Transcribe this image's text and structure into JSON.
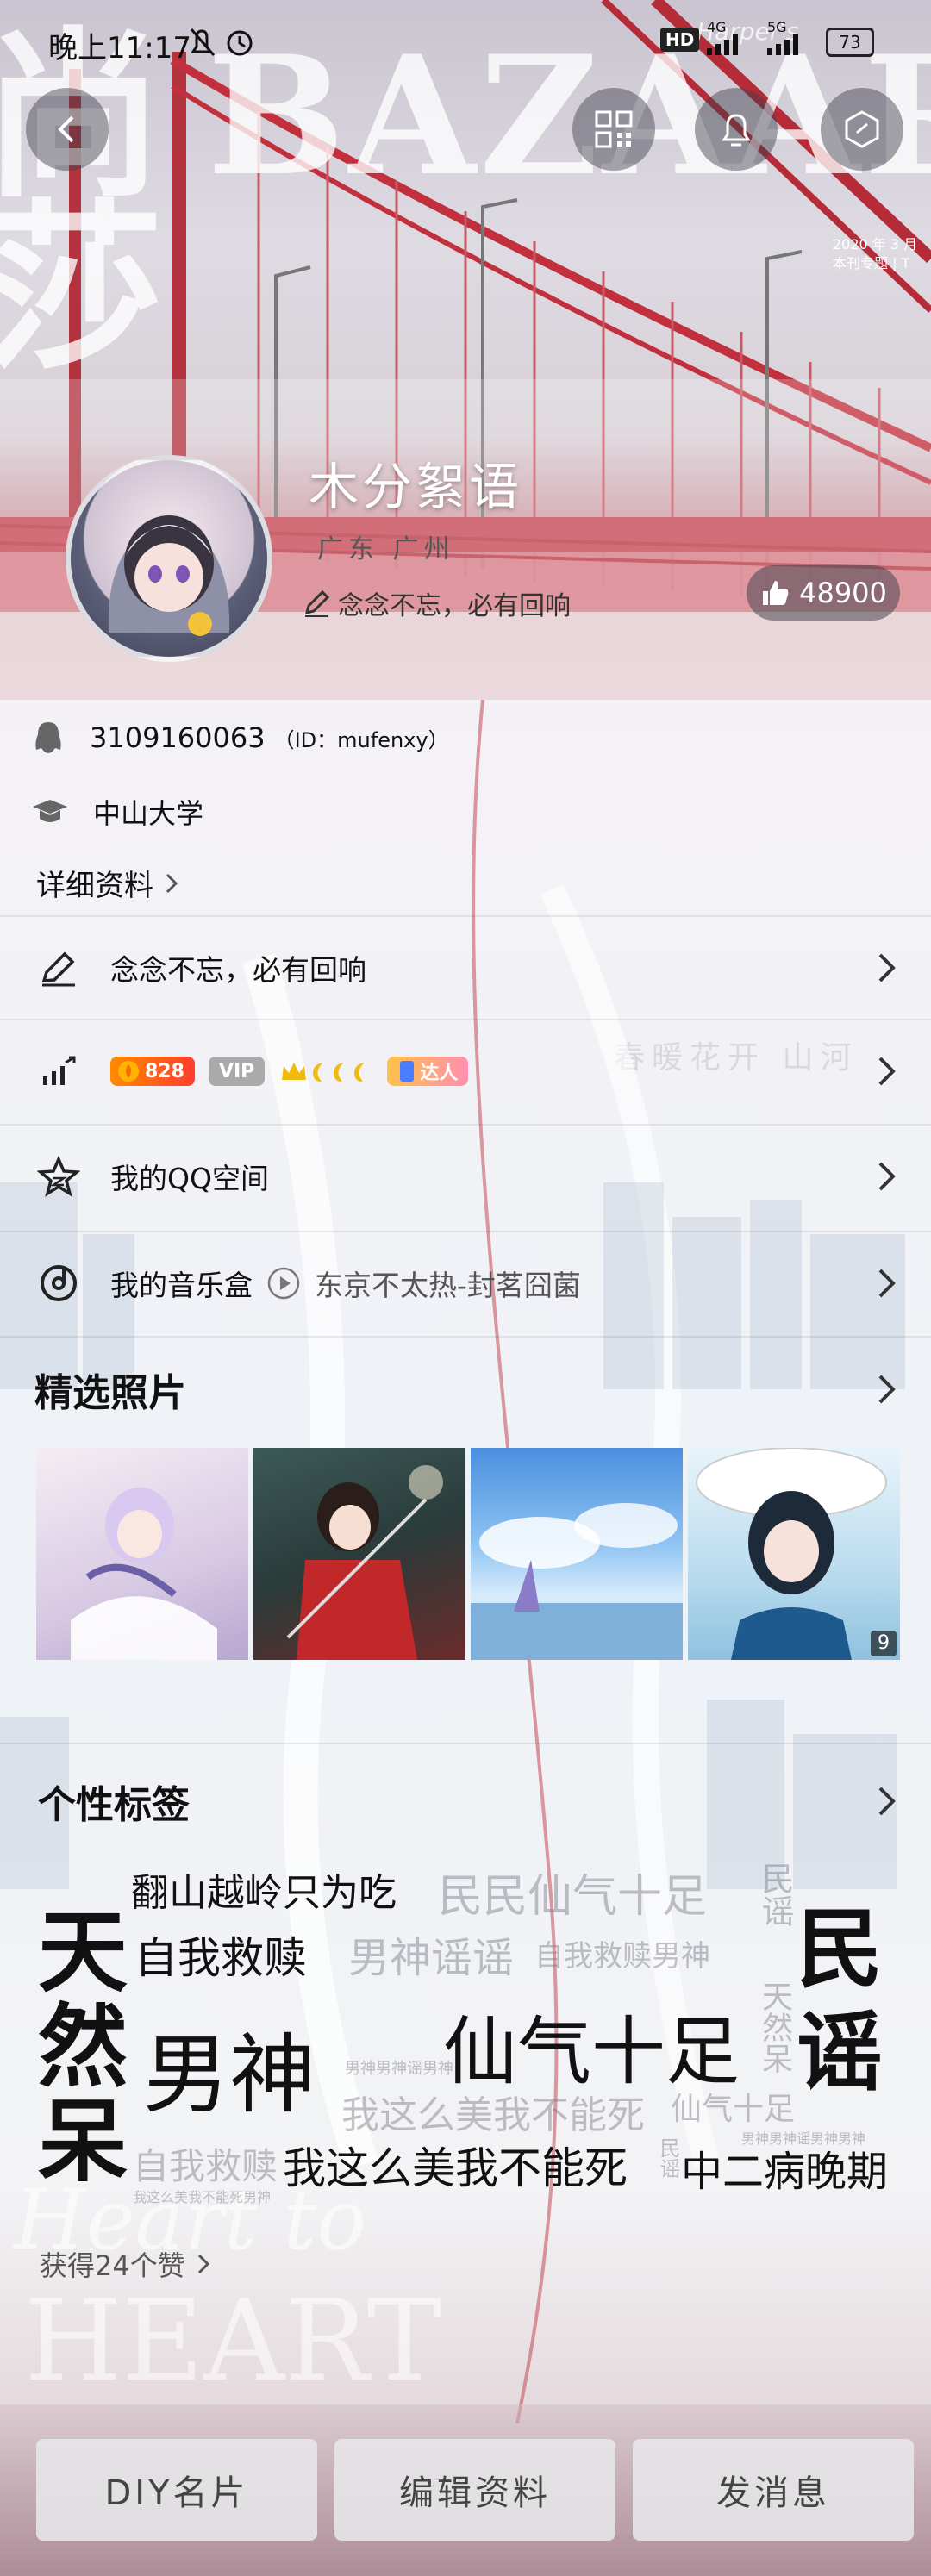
{
  "status_bar": {
    "time": "晚上11:17",
    "hd": "HD",
    "net1": "4G",
    "net2": "5G",
    "battery": "73"
  },
  "cover": {
    "magazine_left": "尚",
    "magazine_left2": "莎",
    "magazine_title": "BAZAAR",
    "magazine_small": "Harper's",
    "magazine_year": "2020 年 3 月",
    "magazine_note": "本刊专题 | T"
  },
  "profile": {
    "name": "木分絮语",
    "location": "广东 广州",
    "signature": "念念不忘，必有回响",
    "likes": "48900"
  },
  "info": {
    "qq_number": "3109160063",
    "qq_id": "（ID：mufenxy）",
    "school": "中山大学",
    "detail_link": "详细资料"
  },
  "menu": {
    "signature_row": "念念不忘，必有回响",
    "level_badge": "828",
    "vip_badge": "VIP",
    "talent_badge": "达人",
    "qzone": "我的QQ空间",
    "music_label": "我的音乐盒",
    "music_song": "东京不太热-封茗囧菌"
  },
  "photos": {
    "title": "精选照片",
    "count_badge": "9"
  },
  "tags": {
    "title": "个性标签",
    "t1": "翻山越岭只为吃",
    "t2": "民民仙气十足",
    "t3": "民谣",
    "t4": "自我救赎",
    "t5": "男神谣谣",
    "t6": "自我救赎男神",
    "t7": "天",
    "t8": "然",
    "t9": "呆",
    "t10": "男神",
    "t11": "仙气十足",
    "t12": "天然呆",
    "t13": "民",
    "t14": "谣",
    "t15": "我这么美我不能死",
    "t16": "仙气十足",
    "t17": "自我救赎",
    "t18": "我这么美我不能死",
    "t19": "中二病晚期",
    "t20": "男神男神谣男神",
    "t21": "我这么美我不能死男神",
    "t22": "男神男神谣男神男神",
    "t23": "民谣",
    "likes_link": "获得24个赞"
  },
  "watermark": {
    "text1": "春暖花开  山河",
    "text2": "Heart to",
    "text3": "HEART"
  },
  "buttons": {
    "diy": "DIY名片",
    "edit": "编辑资料",
    "message": "发消息"
  }
}
